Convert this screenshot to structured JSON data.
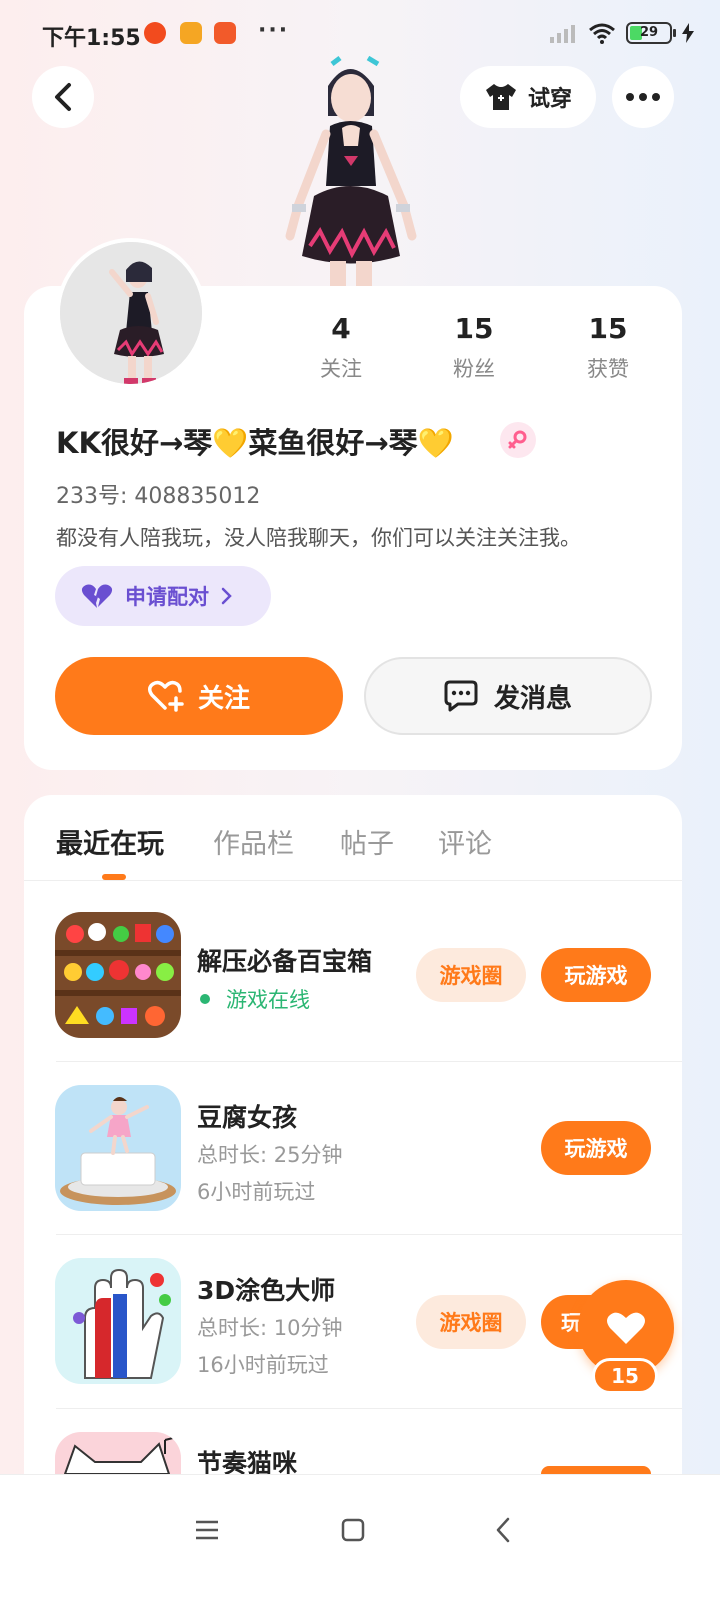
{
  "status_bar": {
    "time": "下午1:55",
    "battery_level": "29",
    "icons": [
      "weibo-icon",
      "notes-icon",
      "video-icon",
      "more-dots-icon",
      "signal-icon",
      "wifi-icon",
      "battery-icon",
      "charging-icon"
    ]
  },
  "header": {
    "try_on_label": "试穿",
    "icons": [
      "back-arrow-icon",
      "tshirt-icon",
      "more-icon"
    ]
  },
  "profile": {
    "stats": [
      {
        "value": "4",
        "label": "关注"
      },
      {
        "value": "15",
        "label": "粉丝"
      },
      {
        "value": "15",
        "label": "获赞"
      }
    ],
    "nickname": "KK很好→琴💛菜鱼很好→琴💛",
    "uid": "233号: 408835012",
    "bio": "都没有人陪我玩，没人陪我聊天，你们可以关注关注我。",
    "pair_label": "申请配对",
    "follow_label": "关注",
    "message_label": "发消息",
    "gender": "female"
  },
  "tabs": [
    {
      "label": "最近在玩",
      "active": true
    },
    {
      "label": "作品栏",
      "active": false
    },
    {
      "label": "帖子",
      "active": false
    },
    {
      "label": "评论",
      "active": false
    }
  ],
  "games": [
    {
      "title": "解压必备百宝箱",
      "online": "游戏在线",
      "circle_label": "游戏圈",
      "play_label": "玩游戏"
    },
    {
      "title": "豆腐女孩",
      "duration": "总时长: 25分钟",
      "last_played": "6小时前玩过",
      "play_label": "玩游戏"
    },
    {
      "title": "3D涂色大师",
      "duration": "总时长: 10分钟",
      "last_played": "16小时前玩过",
      "circle_label": "游戏圈",
      "play_label": "玩"
    },
    {
      "title": "节奏猫咪"
    }
  ],
  "like_fab": {
    "count": "15"
  },
  "colors": {
    "accent": "#ff7a1a",
    "pair_purple": "#6a4fd1",
    "online_green": "#2bb673"
  }
}
